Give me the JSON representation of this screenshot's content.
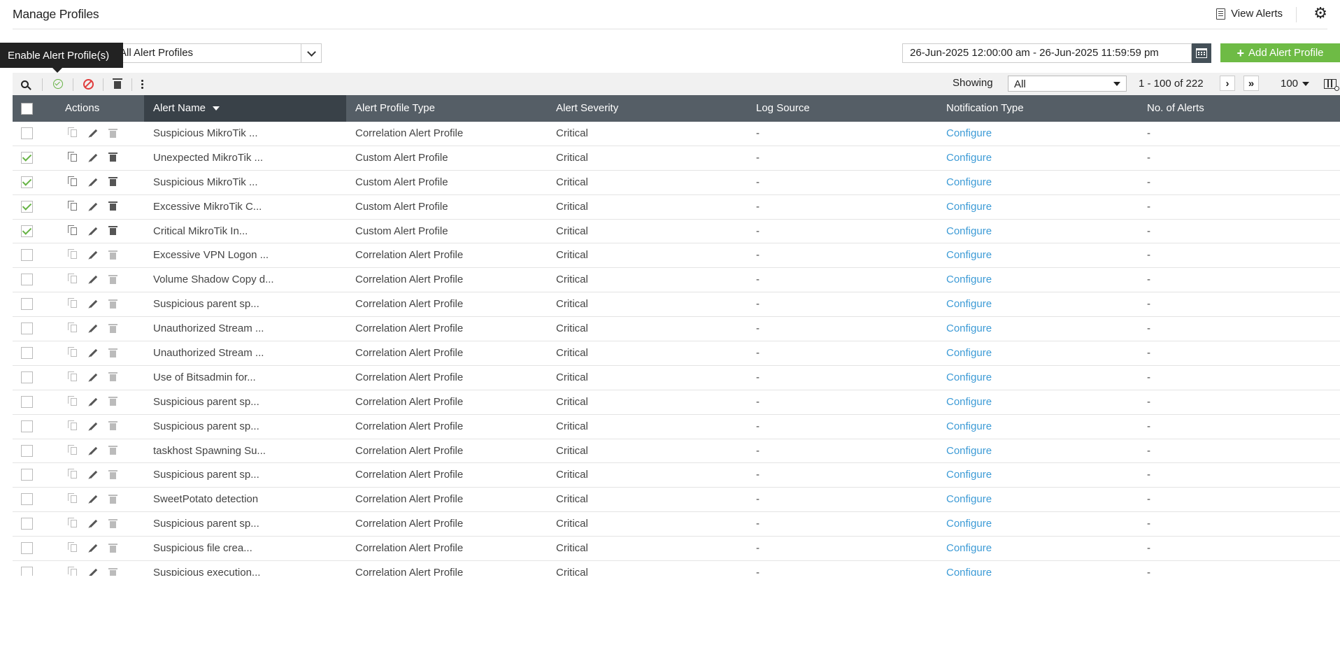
{
  "header": {
    "title": "Manage Profiles",
    "view_alerts_label": "View Alerts"
  },
  "filter": {
    "selected": "All Alert Profiles"
  },
  "tooltip": "Enable Alert Profile(s)",
  "date_range": "26-Jun-2025 12:00:00 am - 26-Jun-2025 11:59:59 pm",
  "add_button_label": "Add Alert Profile",
  "toolbar": {
    "showing_label": "Showing",
    "showing_value": "All",
    "range_text": "1 - 100 of 222",
    "per_page": "100"
  },
  "table": {
    "headers": {
      "actions": "Actions",
      "alert_name": "Alert Name",
      "profile_type": "Alert Profile Type",
      "severity": "Alert Severity",
      "log_source": "Log Source",
      "notification": "Notification Type",
      "alerts_count": "No. of Alerts"
    },
    "rows": [
      {
        "name": "Suspicious MikroTik ...",
        "type": "Correlation Alert Profile",
        "severity": "Critical",
        "log_source": "-",
        "notification": "Configure",
        "count": "-",
        "enabled": false
      },
      {
        "name": "Unexpected MikroTik ...",
        "type": "Custom Alert Profile",
        "severity": "Critical",
        "log_source": "-",
        "notification": "Configure",
        "count": "-",
        "enabled": true
      },
      {
        "name": "Suspicious MikroTik ...",
        "type": "Custom Alert Profile",
        "severity": "Critical",
        "log_source": "-",
        "notification": "Configure",
        "count": "-",
        "enabled": true
      },
      {
        "name": "Excessive MikroTik C...",
        "type": "Custom Alert Profile",
        "severity": "Critical",
        "log_source": "-",
        "notification": "Configure",
        "count": "-",
        "enabled": true
      },
      {
        "name": "Critical MikroTik In...",
        "type": "Custom Alert Profile",
        "severity": "Critical",
        "log_source": "-",
        "notification": "Configure",
        "count": "-",
        "enabled": true
      },
      {
        "name": "Excessive VPN Logon ...",
        "type": "Correlation Alert Profile",
        "severity": "Critical",
        "log_source": "-",
        "notification": "Configure",
        "count": "-",
        "enabled": false
      },
      {
        "name": "Volume Shadow Copy d...",
        "type": "Correlation Alert Profile",
        "severity": "Critical",
        "log_source": "-",
        "notification": "Configure",
        "count": "-",
        "enabled": false
      },
      {
        "name": "Suspicious parent sp...",
        "type": "Correlation Alert Profile",
        "severity": "Critical",
        "log_source": "-",
        "notification": "Configure",
        "count": "-",
        "enabled": false
      },
      {
        "name": "Unauthorized Stream ...",
        "type": "Correlation Alert Profile",
        "severity": "Critical",
        "log_source": "-",
        "notification": "Configure",
        "count": "-",
        "enabled": false
      },
      {
        "name": "Unauthorized Stream ...",
        "type": "Correlation Alert Profile",
        "severity": "Critical",
        "log_source": "-",
        "notification": "Configure",
        "count": "-",
        "enabled": false
      },
      {
        "name": "Use of Bitsadmin for...",
        "type": "Correlation Alert Profile",
        "severity": "Critical",
        "log_source": "-",
        "notification": "Configure",
        "count": "-",
        "enabled": false
      },
      {
        "name": "Suspicious parent sp...",
        "type": "Correlation Alert Profile",
        "severity": "Critical",
        "log_source": "-",
        "notification": "Configure",
        "count": "-",
        "enabled": false
      },
      {
        "name": "Suspicious parent sp...",
        "type": "Correlation Alert Profile",
        "severity": "Critical",
        "log_source": "-",
        "notification": "Configure",
        "count": "-",
        "enabled": false
      },
      {
        "name": "taskhost Spawning Su...",
        "type": "Correlation Alert Profile",
        "severity": "Critical",
        "log_source": "-",
        "notification": "Configure",
        "count": "-",
        "enabled": false
      },
      {
        "name": "Suspicious parent sp...",
        "type": "Correlation Alert Profile",
        "severity": "Critical",
        "log_source": "-",
        "notification": "Configure",
        "count": "-",
        "enabled": false
      },
      {
        "name": "SweetPotato detection",
        "type": "Correlation Alert Profile",
        "severity": "Critical",
        "log_source": "-",
        "notification": "Configure",
        "count": "-",
        "enabled": false
      },
      {
        "name": "Suspicious parent sp...",
        "type": "Correlation Alert Profile",
        "severity": "Critical",
        "log_source": "-",
        "notification": "Configure",
        "count": "-",
        "enabled": false
      },
      {
        "name": "Suspicious file crea...",
        "type": "Correlation Alert Profile",
        "severity": "Critical",
        "log_source": "-",
        "notification": "Configure",
        "count": "-",
        "enabled": false
      },
      {
        "name": "Suspicious execution...",
        "type": "Correlation Alert Profile",
        "severity": "Critical",
        "log_source": "-",
        "notification": "Configure",
        "count": "-",
        "enabled": false
      }
    ]
  },
  "colors": {
    "accent_green": "#6ebb45",
    "header_bg": "#555e66",
    "sorted_header_bg": "#394148",
    "link": "#3d9bd6",
    "disable_red": "#e03c3c"
  }
}
